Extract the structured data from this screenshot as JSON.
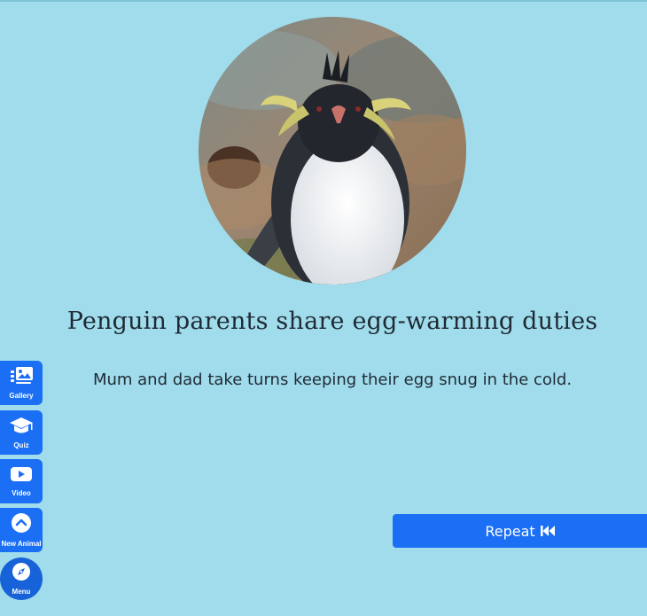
{
  "lesson": {
    "title": "Penguin parents share egg-warming duties",
    "subtitle": "Mum and dad take turns keeping their egg snug in the cold."
  },
  "photo": {
    "subject": "rockhopper penguin"
  },
  "actions": {
    "repeat_label": "Repeat",
    "repeat_icon": "rewind-icon"
  },
  "sidebar": {
    "items": [
      {
        "label": "Gallery",
        "icon": "gallery-icon"
      },
      {
        "label": "Quiz",
        "icon": "graduation-cap-icon"
      },
      {
        "label": "Video",
        "icon": "play-icon"
      },
      {
        "label": "New Animal",
        "icon": "chevron-up-icon"
      },
      {
        "label": "Menu",
        "icon": "compass-icon"
      }
    ]
  },
  "colors": {
    "background": "#a0dcec",
    "button": "#1b6ff5",
    "text": "#1f2a33"
  }
}
